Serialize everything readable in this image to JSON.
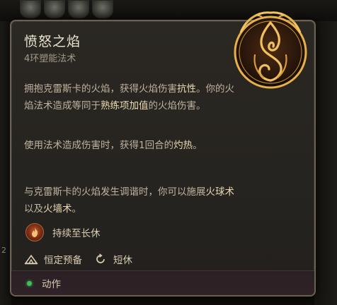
{
  "spell": {
    "name": "愤怒之焰",
    "level_school": "4环塑能法术"
  },
  "description": {
    "p1": [
      "拥抱克雷斯卡的火焰，获得火焰伤害",
      "抗性",
      "。你的火焰法术造成等同于",
      "熟练项加值",
      "的火焰伤害。"
    ],
    "p2": [
      "使用法术造成伤害时，获得1回合的",
      "灼热",
      "。"
    ],
    "p3": [
      "与克雷斯卡的火焰发生调谐时，你可以施展",
      "火球术",
      "以及",
      "火墙术",
      "。"
    ]
  },
  "duration": {
    "icon": "flame-aura-icon",
    "label": "持续至长休"
  },
  "properties": {
    "concentration_icon": "rest-camp-icon",
    "concentration_label": "恒定预备",
    "recharge_icon": "short-rest-cycle-icon",
    "recharge_label": "短休"
  },
  "footer": {
    "indicator_color": "#3fbf57",
    "label": "动作"
  },
  "background": {
    "slot_number": "2"
  },
  "colors": {
    "emblem_gold": "#e7b04a",
    "highlight_text": "#ead9b4",
    "body_text": "#bfb39f"
  }
}
